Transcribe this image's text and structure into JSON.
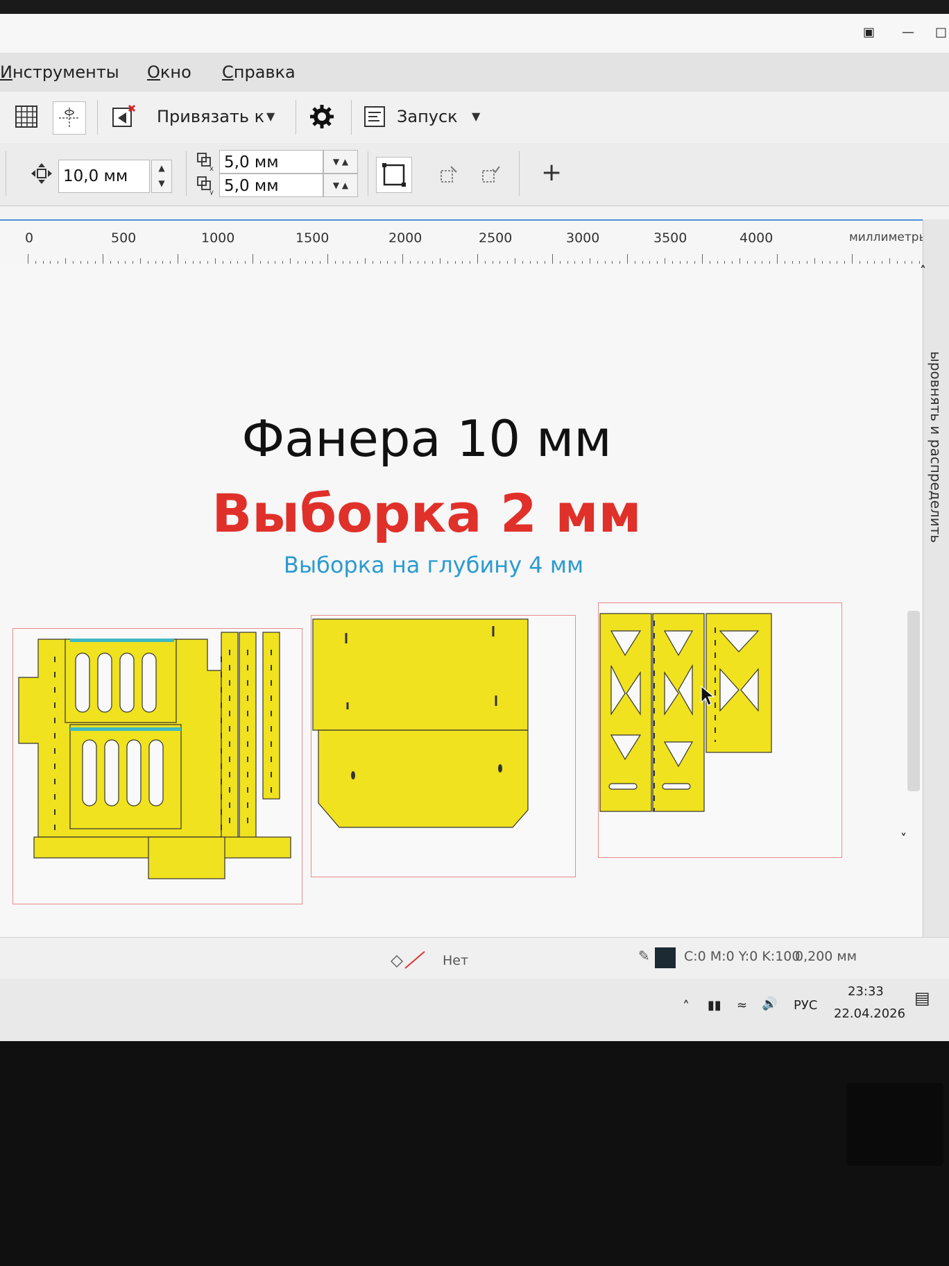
{
  "menu": {
    "tools": "Инструменты",
    "window": "Окно",
    "help": "Справка"
  },
  "toolbar": {
    "snap_label": "Привязать к",
    "launch_label": "Запуск",
    "nudge_value": "10,0 мм",
    "dup_x_value": "5,0 мм",
    "dup_y_value": "5,0 мм"
  },
  "ruler": {
    "ticks": [
      "0",
      "500",
      "1000",
      "1500",
      "2000",
      "2500",
      "3000",
      "3500",
      "4000"
    ],
    "unit": "миллиметры"
  },
  "canvas": {
    "title": "Фанера 10 мм",
    "subtitle": "Выборка 2 мм",
    "note": "Выборка на глубину 4 мм"
  },
  "side_panel": {
    "tab_label": "ыровнять и распределить"
  },
  "status": {
    "fill_label": "Нет",
    "outline_color": "C:0 M:0 Y:0 K:100",
    "outline_width": "0,200 мм"
  },
  "tray": {
    "language": "РУС",
    "time": "23:33",
    "date": "22.04.2026"
  },
  "colors": {
    "part_fill": "#f0e21e",
    "subtitle": "#e0302a",
    "note": "#2b9bd0"
  }
}
